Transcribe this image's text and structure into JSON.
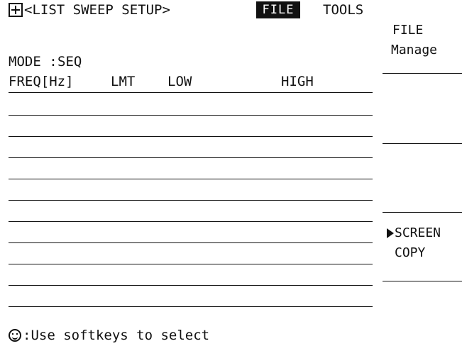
{
  "header": {
    "title": "<LIST SWEEP SETUP>",
    "active_menu": "FILE",
    "tools_menu": "TOOLS"
  },
  "mode": {
    "label": "MODE :",
    "value": "SEQ"
  },
  "table": {
    "columns": [
      "FREQ[Hz]",
      "LMT",
      "LOW",
      "HIGH"
    ],
    "rows": [
      "",
      "",
      "",
      "",
      "",
      "",
      "",
      "",
      "",
      ""
    ]
  },
  "softkeys": [
    {
      "line1": "FILE",
      "line2": "Manage"
    },
    {
      "line1": "",
      "line2": ""
    },
    {
      "line1": "",
      "line2": ""
    },
    {
      "line1": "SCREEN",
      "line2": "COPY",
      "selected": true
    },
    {
      "line1": "",
      "line2": ""
    }
  ],
  "status": {
    "message": ":Use softkeys to select"
  },
  "icons": [
    "menu-cross-icon",
    "smiley-icon",
    "softkey-pointer-icon"
  ]
}
